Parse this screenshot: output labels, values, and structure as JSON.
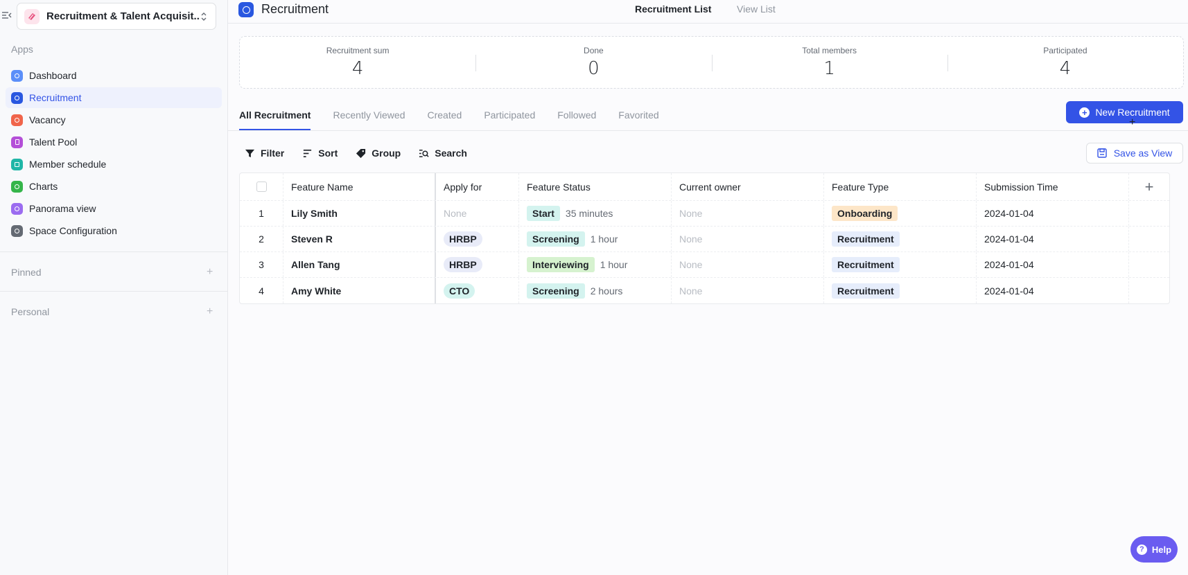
{
  "space": {
    "name": "Recruitment & Talent Acquisit..."
  },
  "sidebar": {
    "apps_title": "Apps",
    "items": [
      {
        "label": "Dashboard",
        "color": "#5b8ff9"
      },
      {
        "label": "Recruitment",
        "color": "#2957e0"
      },
      {
        "label": "Vacancy",
        "color": "#f0654b"
      },
      {
        "label": "Talent Pool",
        "color": "#b44fd8"
      },
      {
        "label": "Member schedule",
        "color": "#1fb6a7"
      },
      {
        "label": "Charts",
        "color": "#35b54a"
      },
      {
        "label": "Panorama view",
        "color": "#9b6cf0"
      },
      {
        "label": "Space Configuration",
        "color": "#646a73"
      }
    ],
    "pinned_title": "Pinned",
    "personal_title": "Personal"
  },
  "header": {
    "title": "Recruitment",
    "view_tabs": [
      "Recruitment List",
      "View List"
    ]
  },
  "stats": [
    {
      "label": "Recruitment sum",
      "value": "4"
    },
    {
      "label": "Done",
      "value": "0"
    },
    {
      "label": "Total members",
      "value": "1"
    },
    {
      "label": "Participated",
      "value": "4"
    }
  ],
  "filter_tabs": [
    "All Recruitment",
    "Recently Viewed",
    "Created",
    "Participated",
    "Followed",
    "Favorited"
  ],
  "new_button": "New Recruitment",
  "toolbar": {
    "filter": "Filter",
    "sort": "Sort",
    "group": "Group",
    "search": "Search",
    "save_view": "Save as View"
  },
  "table": {
    "columns": [
      "Feature Name",
      "Apply for",
      "Feature Status",
      "Current owner",
      "Feature Type",
      "Submission Time"
    ],
    "rows": [
      {
        "num": "1",
        "name": "Lily Smith",
        "apply": "None",
        "status": "Start",
        "duration": "35 minutes",
        "owner": "None",
        "type": "Onboarding",
        "time": "2024-01-04"
      },
      {
        "num": "2",
        "name": "Steven R",
        "apply": "HRBP",
        "status": "Screening",
        "duration": "1 hour",
        "owner": "None",
        "type": "Recruitment",
        "time": "2024-01-04"
      },
      {
        "num": "3",
        "name": "Allen Tang",
        "apply": "HRBP",
        "status": "Interviewing",
        "duration": "1 hour",
        "owner": "None",
        "type": "Recruitment",
        "time": "2024-01-04"
      },
      {
        "num": "4",
        "name": "Amy White",
        "apply": "CTO",
        "status": "Screening",
        "duration": "2 hours",
        "owner": "None",
        "type": "Recruitment",
        "time": "2024-01-04"
      }
    ]
  },
  "help": "Help"
}
